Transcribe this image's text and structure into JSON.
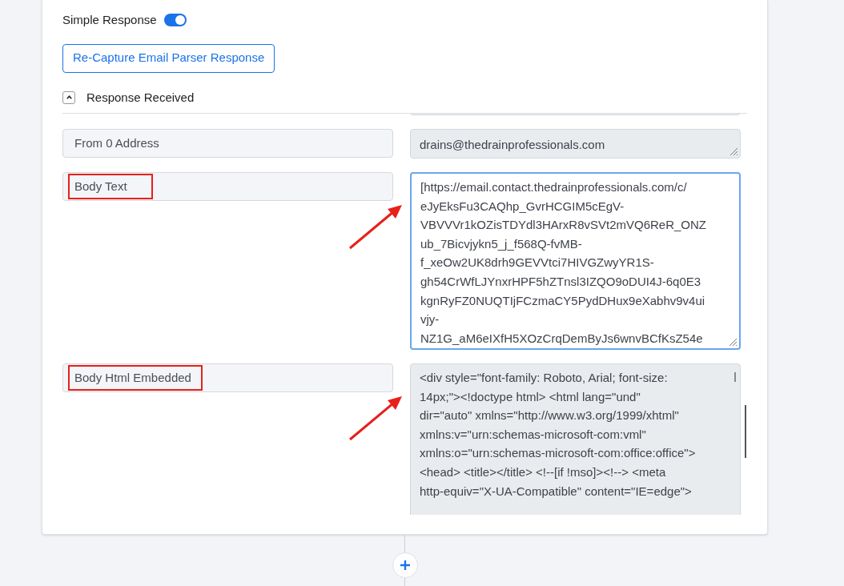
{
  "toggle": {
    "label": "Simple Response",
    "on": true
  },
  "recapture_button": {
    "label": "Re-Capture Email Parser Response"
  },
  "section": {
    "title": "Response Received",
    "expanded": true
  },
  "fields": [
    {
      "kind": "single",
      "label": "From 0 Address",
      "highlighted": false,
      "focused": false,
      "value_lines": [
        "drains@thedrainprofessionals.com"
      ]
    },
    {
      "kind": "multi",
      "label": "Body Text",
      "highlighted": true,
      "focused": true,
      "value_lines": [
        "[https://email.contact.thedrainprofessionals.com/c/",
        "eJyEksFu3CAQhp_GvrHCGIM5cEgV-",
        "VBVVVr1kOZisTDYdl3HArxR8vSVt2mVQ6ReR_ONZ",
        "ub_7Bicvjykn5_j_f568Q-fvMB-",
        "f_xeOw2UK8drh9GEVVtci7HIVGZwyYR1S-",
        "gh54CrWfLJYnxrHPF5hZTnsl3IZQO9oDUI4J-6q0E3",
        "kgnRyFZ0NUQTIjFCzmaCY5PydDHux9eXabhv9v4ui",
        "vjy-",
        "NZ1G_aM6eIXfH5XOzCrqDemByJs6wnvBCfKsZ54e"
      ]
    },
    {
      "kind": "tall",
      "label": "Body Html Embedded",
      "highlighted": true,
      "focused": false,
      "value_lines": [
        "<div style=\"font-family: Roboto, Arial; font-size:",
        "14px;\"><!doctype html> <html lang=\"und\"",
        "dir=\"auto\" xmlns=\"http://www.w3.org/1999/xhtml\"",
        "xmlns:v=\"urn:schemas-microsoft-com:vml\"",
        "xmlns:o=\"urn:schemas-microsoft-com:office:office\">",
        "<head> <title></title> <!--[if !mso]><!--> <meta",
        "http-equiv=\"X-UA-Compatible\" content=\"IE=edge\">"
      ]
    }
  ]
}
